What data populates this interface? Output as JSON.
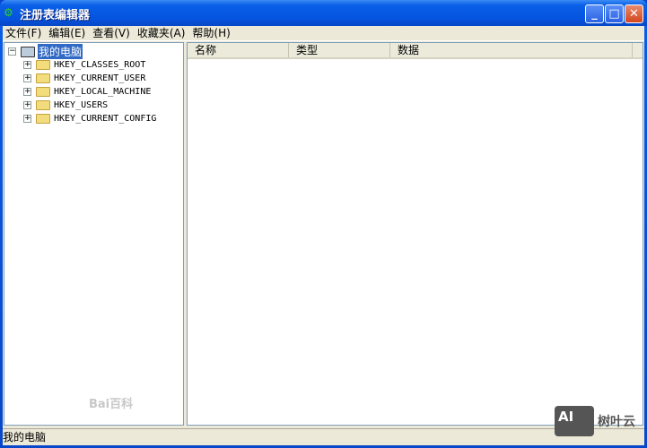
{
  "window": {
    "title": "注册表编辑器",
    "minimize": "_",
    "maximize": "□",
    "close": "✕"
  },
  "menu": [
    "文件(F)",
    "编辑(E)",
    "查看(V)",
    "收藏夹(A)",
    "帮助(H)"
  ],
  "tree": {
    "root": "我的电脑",
    "keys": [
      "HKEY_CLASSES_ROOT",
      "HKEY_CURRENT_USER",
      "HKEY_LOCAL_MACHINE",
      "HKEY_USERS",
      "HKEY_CURRENT_CONFIG"
    ]
  },
  "columns": [
    "名称",
    "类型",
    "数据"
  ],
  "status": "我的电脑",
  "watermarks": {
    "baidu": "Bai百科",
    "brand_logo": "AI",
    "brand": "树叶云"
  }
}
